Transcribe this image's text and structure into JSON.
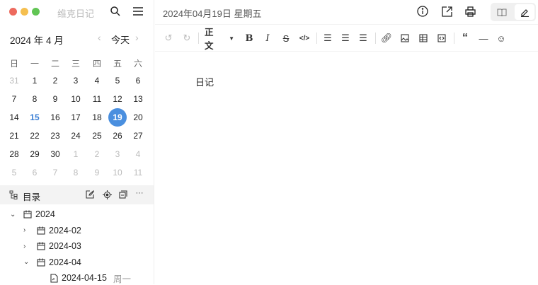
{
  "app": {
    "title": "维克日记"
  },
  "header": {
    "date_title": "2024年04月19日 星期五"
  },
  "calendar": {
    "month_label": "2024 年 4 月",
    "today_button": "今天",
    "weekdays": [
      "日",
      "一",
      "二",
      "三",
      "四",
      "五",
      "六"
    ],
    "weeks": [
      [
        [
          "31",
          1
        ],
        [
          "1",
          0
        ],
        [
          "2",
          0
        ],
        [
          "3",
          0
        ],
        [
          "4",
          0
        ],
        [
          "5",
          0
        ],
        [
          "6",
          0
        ]
      ],
      [
        [
          "7",
          0
        ],
        [
          "8",
          0
        ],
        [
          "9",
          0
        ],
        [
          "10",
          0
        ],
        [
          "11",
          0
        ],
        [
          "12",
          0
        ],
        [
          "13",
          0
        ]
      ],
      [
        [
          "14",
          0
        ],
        [
          "15",
          2
        ],
        [
          "16",
          0
        ],
        [
          "17",
          0
        ],
        [
          "18",
          0
        ],
        [
          "19",
          3
        ],
        [
          "20",
          0
        ]
      ],
      [
        [
          "21",
          0
        ],
        [
          "22",
          0
        ],
        [
          "23",
          0
        ],
        [
          "24",
          0
        ],
        [
          "25",
          0
        ],
        [
          "26",
          0
        ],
        [
          "27",
          0
        ]
      ],
      [
        [
          "28",
          0
        ],
        [
          "29",
          0
        ],
        [
          "30",
          0
        ],
        [
          "1",
          1
        ],
        [
          "2",
          1
        ],
        [
          "3",
          1
        ],
        [
          "4",
          1
        ]
      ],
      [
        [
          "5",
          1
        ],
        [
          "6",
          1
        ],
        [
          "7",
          1
        ],
        [
          "8",
          1
        ],
        [
          "9",
          1
        ],
        [
          "10",
          1
        ],
        [
          "11",
          1
        ]
      ]
    ]
  },
  "outline": {
    "title": "目录",
    "items": [
      {
        "label": "2024",
        "level": 0,
        "expanded": true,
        "type": "folder"
      },
      {
        "label": "2024-02",
        "level": 1,
        "expanded": false,
        "type": "folder"
      },
      {
        "label": "2024-03",
        "level": 1,
        "expanded": false,
        "type": "folder"
      },
      {
        "label": "2024-04",
        "level": 1,
        "expanded": true,
        "type": "folder"
      },
      {
        "label": "2024-04-15",
        "suffix": "周一",
        "level": 2,
        "type": "file"
      }
    ]
  },
  "toolbar": {
    "paragraph_style": "正文"
  },
  "editor": {
    "content": "日记"
  },
  "colors": {
    "accent": "#4a8fdf",
    "today": "#3b7fd4"
  }
}
